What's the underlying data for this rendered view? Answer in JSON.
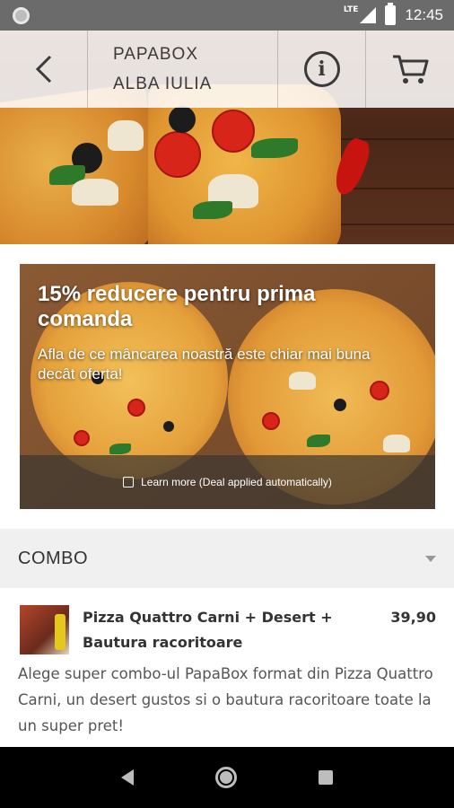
{
  "status_bar": {
    "network": "LTE",
    "time": "12:45"
  },
  "toolbar": {
    "title_line1": "PAPABOX",
    "title_line2": "ALBA IULIA",
    "back_icon": "chevron-left-icon",
    "info_icon": "info-icon",
    "info_glyph": "i",
    "cart_icon": "cart-icon"
  },
  "promo": {
    "title": "15% reducere pentru prima comanda",
    "subtitle": "Afla de ce mâncarea noastră este chiar mai buna decât oferta!",
    "learn_more": "Learn more (Deal applied automatically)"
  },
  "category": {
    "title": "COMBO"
  },
  "item": {
    "name": "Pizza Quattro Carni + Desert + Bautura racoritoare",
    "price": "39,90",
    "description": "Alege super combo-ul PapaBox format din Pizza Quattro Carni, un desert gustos si o bautura racoritoare toate la un super pret!"
  },
  "nav": {
    "back_icon": "back-triangle-icon",
    "home_icon": "home-circle-icon",
    "recents_icon": "recents-square-icon"
  },
  "colors": {
    "toolbar_bg": "#ffffff",
    "category_bg": "#f0f0f0",
    "text_dark": "#333333",
    "navbar_bg": "#000000"
  }
}
